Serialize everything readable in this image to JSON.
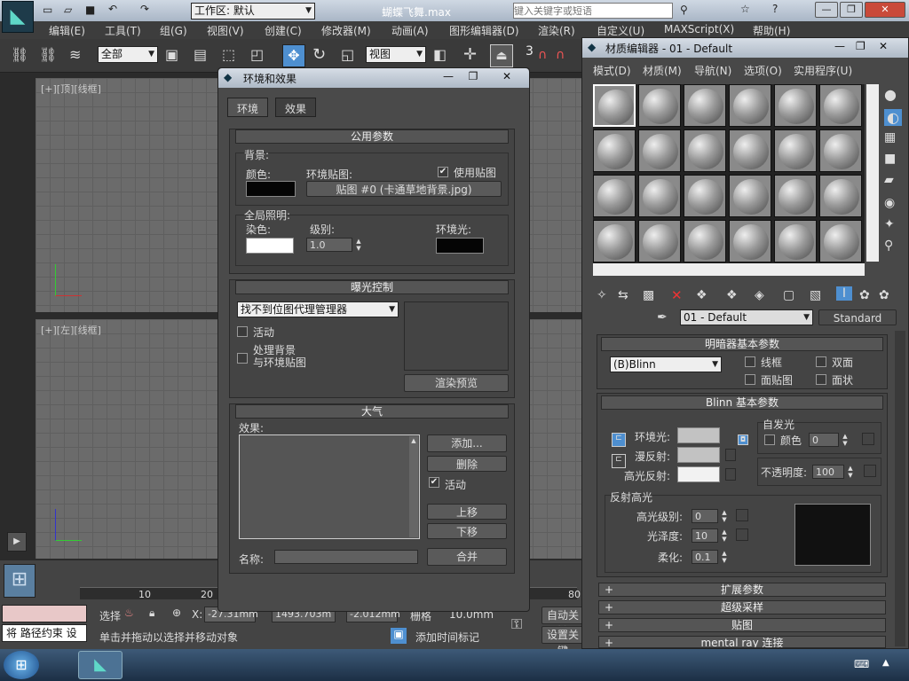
{
  "app": {
    "workspace_label": "工作区: 默认",
    "file_title": "蝴蝶飞舞.max",
    "search_placeholder": "键入关键字或短语"
  },
  "menu": [
    "编辑(E)",
    "工具(T)",
    "组(G)",
    "视图(V)",
    "创建(C)",
    "修改器(M)",
    "动画(A)",
    "图形编辑器(D)",
    "渲染(R)",
    "自定义(U)",
    "MAXScript(X)",
    "帮助(H)"
  ],
  "toolbar": {
    "selection_filter": "全部",
    "ref_coord": "视图",
    "snap_label": "3"
  },
  "viewports": {
    "top": "[+][顶][线框]",
    "left": "[+][左][线框]"
  },
  "timeline": {
    "ticks": [
      "10",
      "20",
      "80"
    ]
  },
  "status": {
    "script_text": "将 路径约束 设",
    "prompt": "单击并拖动以选择并移动对象",
    "add_time_tag": "添加时间标记",
    "auto_key": "自动关键",
    "set_key": "设置关键",
    "select_label": "选择",
    "x_label": "X:",
    "x_value": "-27.31mm",
    "y_value": "1493.703m",
    "z_value": "-2.012mm",
    "grid_label": "栅格",
    "grid_value": "10.0mm"
  },
  "env_dialog": {
    "title": "环境和效果",
    "tabs": [
      "环境",
      "效果"
    ],
    "common_params": {
      "header": "公用参数",
      "background": "背景:",
      "color": "颜色:",
      "env_map": "环境贴图:",
      "use_map": "使用贴图",
      "map_button": "贴图 #0 (卡通草地背景.jpg)",
      "global_lighting": "全局照明:",
      "tint": "染色:",
      "level": "级别:",
      "level_value": "1.0",
      "ambient": "环境光:"
    },
    "exposure": {
      "header": "曝光控制",
      "dropdown": "找不到位图代理管理器",
      "active": "活动",
      "process_bg_line1": "处理背景",
      "process_bg_line2": "与环境贴图",
      "render_preview": "渲染预览"
    },
    "atmosphere": {
      "header": "大气",
      "effects": "效果:",
      "add": "添加...",
      "delete": "删除",
      "active": "活动",
      "move_up": "上移",
      "move_down": "下移",
      "name": "名称:",
      "merge": "合并"
    }
  },
  "material_editor": {
    "title": "材质编辑器 - 01 - Default",
    "menu": [
      "模式(D)",
      "材质(M)",
      "导航(N)",
      "选项(O)",
      "实用程序(U)"
    ],
    "material_name": "01 - Default",
    "material_type": "Standard",
    "shader_header": "明暗器基本参数",
    "shader_type": "(B)Blinn",
    "wire": "线框",
    "two_sided": "双面",
    "face_map": "面贴图",
    "faceted": "面状",
    "blinn_header": "Blinn 基本参数",
    "self_illum": "自发光",
    "self_color": "颜色",
    "self_value": "0",
    "ambient": "环境光:",
    "diffuse": "漫反射:",
    "specular": "高光反射:",
    "opacity": "不透明度:",
    "opacity_value": "100",
    "spec_highlights": "反射高光",
    "spec_level": "高光级别:",
    "spec_level_value": "0",
    "glossiness": "光泽度:",
    "glossiness_value": "10",
    "soften": "柔化:",
    "soften_value": "0.1",
    "rollouts": [
      "扩展参数",
      "超级采样",
      "贴图",
      "mental ray 连接"
    ]
  },
  "colors": {
    "dark_swatch": "#050505",
    "white_swatch": "#ffffff",
    "spec_preview": "#111111"
  }
}
